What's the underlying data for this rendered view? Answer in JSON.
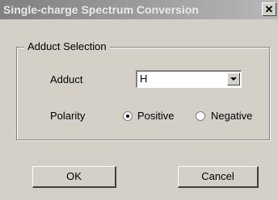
{
  "window": {
    "title": "Single-charge Spectrum Conversion",
    "close_glyph": "✕"
  },
  "group": {
    "legend": "Adduct Selection",
    "adduct_label": "Adduct",
    "adduct_value": "H",
    "polarity_label": "Polarity",
    "polarity_options": [
      {
        "label": "Positive",
        "selected": true
      },
      {
        "label": "Negative",
        "selected": false
      }
    ]
  },
  "buttons": {
    "ok": "OK",
    "cancel": "Cancel"
  }
}
